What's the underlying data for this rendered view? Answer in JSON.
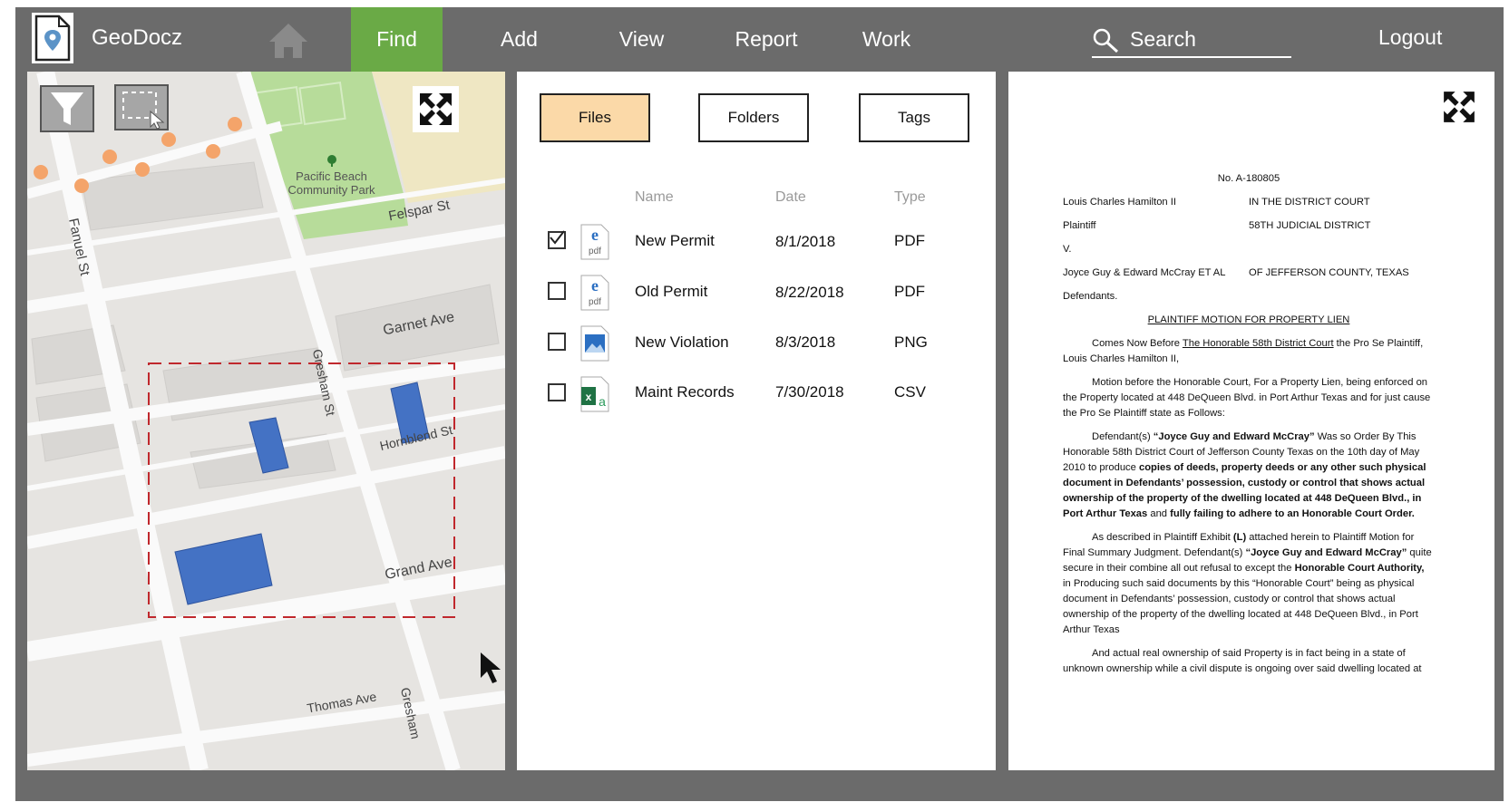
{
  "app": {
    "name": "GeoDocz",
    "logo_icon": "map-pin-document-icon"
  },
  "nav": {
    "items": [
      {
        "label": "Find",
        "active": true
      },
      {
        "label": "Add"
      },
      {
        "label": "View"
      },
      {
        "label": "Report"
      },
      {
        "label": "Work"
      }
    ],
    "home_icon": "home-icon",
    "active_color": "#6aaa46",
    "bar_color": "#6b6b6b"
  },
  "search": {
    "placeholder": "Search",
    "icon": "search-icon"
  },
  "logout_label": "Logout",
  "map": {
    "labels": {
      "park": "Pacific Beach",
      "park2": "Community Park",
      "felspar": "Felspar St",
      "fanuel": "Fanuel St",
      "garnet": "Garnet Ave",
      "gresham": "Gresham St",
      "hornblend": "Hornblend St",
      "grand": "Grand Ave",
      "thomas": "Thomas Ave",
      "gresham2": "Gresham"
    },
    "tools": [
      "filter-icon",
      "rectangle-select-icon",
      "expand-icon"
    ],
    "selection_color": "#c0282d",
    "parcel_color": "#4472c4",
    "marker_color": "#f4a46a"
  },
  "list": {
    "tabs": [
      {
        "label": "Files",
        "active": true
      },
      {
        "label": "Folders"
      },
      {
        "label": "Tags"
      }
    ],
    "columns": [
      "Name",
      "Date",
      "Type"
    ],
    "rows": [
      {
        "checked": true,
        "icon": "pdf-file-icon",
        "name": "New Permit",
        "date": "8/1/2018",
        "type": "PDF"
      },
      {
        "checked": false,
        "icon": "pdf-file-icon",
        "name": "Old Permit",
        "date": "8/22/2018",
        "type": "PDF"
      },
      {
        "checked": false,
        "icon": "image-file-icon",
        "name": "New Violation",
        "date": "8/3/2018",
        "type": "PNG"
      },
      {
        "checked": false,
        "icon": "excel-file-icon",
        "name": "Maint Records",
        "date": "7/30/2018",
        "type": "CSV"
      }
    ],
    "active_tab_color": "#fbd9a8"
  },
  "document": {
    "case_no": "No. A-180805",
    "line1_left": "Louis Charles Hamilton II",
    "line1_right": "IN THE DISTRICT COURT",
    "line2_left": "Plaintiff",
    "line2_right": "58TH JUDICIAL DISTRICT",
    "line3": "V.",
    "line4_left": "Joyce Guy & Edward McCray ET AL",
    "line4_right": "OF JEFFERSON COUNTY, TEXAS",
    "line5": "Defendants.",
    "heading": "PLAINTIFF MOTION FOR PROPERTY LIEN",
    "p1_a": "Comes Now Before ",
    "p1_u": "The Honorable 58th District Court",
    "p1_b": " the Pro Se Plaintiff, Louis Charles Hamilton II,",
    "p2": "Motion before the Honorable Court, For a Property Lien, being enforced on the Property located at 448 DeQueen Blvd. in Port Arthur Texas and for just cause the Pro Se Plaintiff state as Follows:",
    "p3_a": "Defendant(s) ",
    "p3_b": "“Joyce Guy and Edward McCray”",
    "p3_c": " Was so Order By This Honorable 58th District Court of Jefferson County Texas on the 10th day of May 2010 to produce ",
    "p3_d": "copies of deeds, property deeds or any other such physical document in Defendants’ possession, custody or control that shows actual ownership of the property of the dwelling located at 448 DeQueen Blvd., in Port Arthur Texas",
    "p3_e": " and ",
    "p3_f": "fully failing to adhere to an Honorable Court Order.",
    "p4_a": "As described in Plaintiff Exhibit ",
    "p4_b": "(L)",
    "p4_c": " attached herein to Plaintiff Motion for Final Summary Judgment. Defendant(s) ",
    "p4_d": "“Joyce Guy and Edward McCray”",
    "p4_e": " quite secure in their combine all out refusal to except the ",
    "p4_f": "Honorable Court Authority,",
    "p4_g": " in Producing such said documents by this “Honorable Court” being as physical document in Defendants’ possession, custody or control that shows actual ownership of the property of the dwelling located at 448 DeQueen Blvd., in Port Arthur Texas",
    "p5": "And actual real ownership of said Property is in fact being in a state of unknown ownership while a civil dispute is ongoing over said dwelling located at"
  }
}
